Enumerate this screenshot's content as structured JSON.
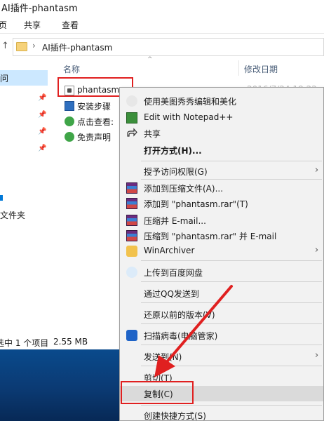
{
  "window": {
    "title": "AI插件-phantasm"
  },
  "ribbon": {
    "tabs": [
      "页",
      "共享",
      "查看"
    ]
  },
  "address": {
    "separator": "›",
    "path": "AI插件-phantasm"
  },
  "nav": {
    "selected_item": "问",
    "item2": "文件夹"
  },
  "columns": {
    "name": "名称",
    "modified": "修改日期"
  },
  "files": [
    {
      "name": "phantasm",
      "icon": "app-icon"
    },
    {
      "name": "安装步骤",
      "icon": "document-icon"
    },
    {
      "name": "点击查看:",
      "icon": "url-icon"
    },
    {
      "name": "免责声明",
      "icon": "url-icon"
    }
  ],
  "file_date_partial": "2016/7/24 18:22",
  "status": {
    "selection": "选中 1 个项目",
    "size": "2.55 MB"
  },
  "context_menu": {
    "items": [
      {
        "label": "使用美图秀秀编辑和美化",
        "icon": "meitu-icon"
      },
      {
        "label": "Edit with Notepad++",
        "icon": "notepad-icon"
      },
      {
        "label": "共享",
        "icon": "share-icon"
      },
      {
        "label": "打开方式(H)...",
        "icon": ""
      },
      {
        "label": "授予访问权限(G)",
        "icon": ""
      },
      {
        "label": "添加到压缩文件(A)...",
        "icon": "winrar-icon"
      },
      {
        "label": "添加到 \"phantasm.rar\"(T)",
        "icon": "winrar-icon"
      },
      {
        "label": "压缩并 E-mail...",
        "icon": "winrar-icon"
      },
      {
        "label": "压缩到 \"phantasm.rar\" 并 E-mail",
        "icon": "winrar-icon"
      },
      {
        "label": "WinArchiver",
        "icon": "winarchiver-icon"
      },
      {
        "label": "上传到百度网盘",
        "icon": "baidu-cloud-icon"
      },
      {
        "label": "通过QQ发送到",
        "icon": ""
      },
      {
        "label": "还原以前的版本(V)",
        "icon": ""
      },
      {
        "label": "扫描病毒(电脑管家)",
        "icon": "shield-icon"
      },
      {
        "label": "发送到(N)",
        "icon": ""
      },
      {
        "label": "剪切(T)",
        "icon": ""
      },
      {
        "label": "复制(C)",
        "icon": ""
      },
      {
        "label": "创建快捷方式(S)",
        "icon": ""
      }
    ]
  },
  "colors": {
    "highlight": "#cce8ff",
    "annotation": "#e02020",
    "menu_bg": "#f2f2f2"
  }
}
